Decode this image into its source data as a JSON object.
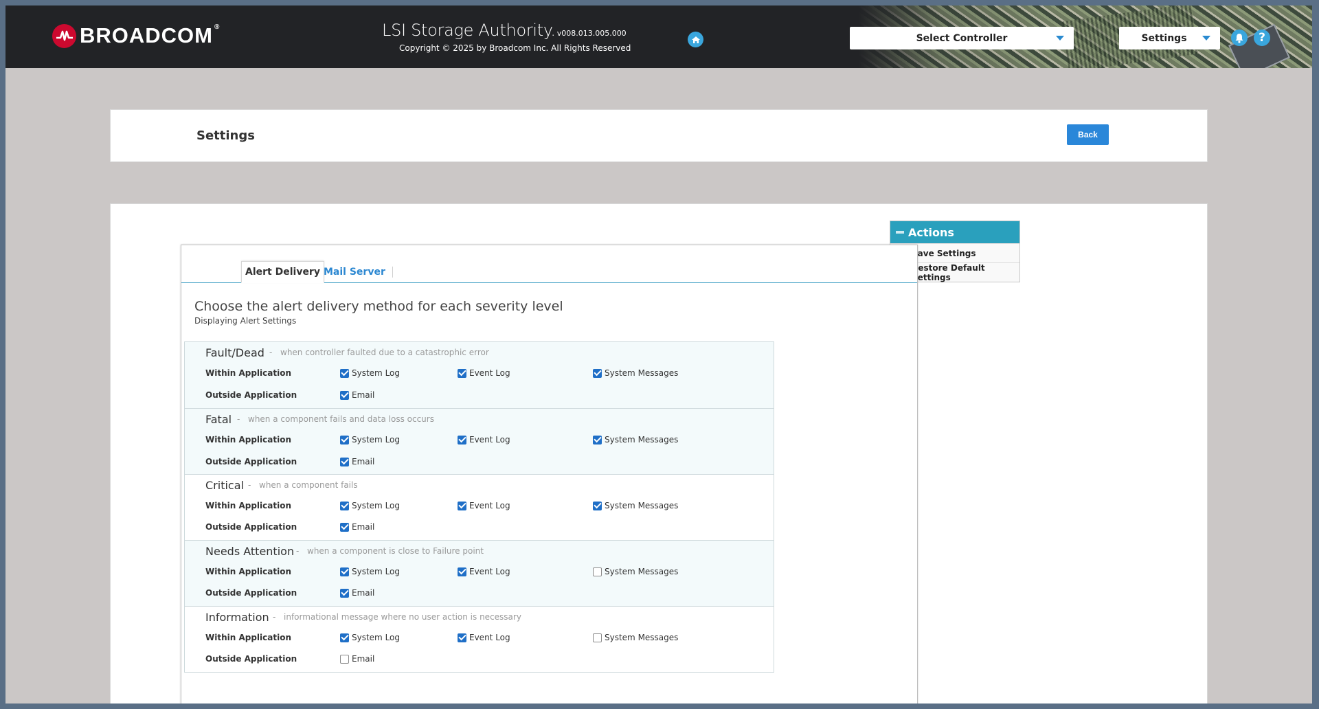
{
  "header": {
    "brand": "BROADCOM",
    "brand_mark": "®",
    "app_name": "LSI Storage Authority.",
    "version": "v008.013.005.000",
    "copyright": "Copyright © 2025 by Broadcom Inc. All Rights Reserved",
    "select_controller": "Select Controller",
    "settings_menu": "Settings",
    "help": "?"
  },
  "page": {
    "title": "Settings",
    "back": "Back"
  },
  "actions": {
    "title": "Actions",
    "save": "Save Settings",
    "restore": "Restore Default Settings"
  },
  "tabs": {
    "alert_delivery": "Alert Delivery",
    "mail_server": "Mail Server"
  },
  "main": {
    "heading": "Choose the alert delivery method for each severity level",
    "subheading": "Displaying Alert Settings"
  },
  "labels": {
    "within": "Within Application",
    "outside": "Outside Application",
    "system_log": "System Log",
    "event_log": "Event Log",
    "system_messages": "System Messages",
    "email": "Email",
    "dash": "-"
  },
  "severities": [
    {
      "name": "Fault/Dead",
      "desc": "when controller faulted due to a catastrophic error",
      "system_log": true,
      "event_log": true,
      "system_messages": true,
      "email": true
    },
    {
      "name": "Fatal",
      "desc": "when a component fails and data loss occurs",
      "system_log": true,
      "event_log": true,
      "system_messages": true,
      "email": true
    },
    {
      "name": "Critical",
      "desc": "when a component fails",
      "system_log": true,
      "event_log": true,
      "system_messages": true,
      "email": true
    },
    {
      "name": "Needs Attention",
      "desc": "when a component is close to Failure point",
      "system_log": true,
      "event_log": true,
      "system_messages": false,
      "email": true
    },
    {
      "name": "Information",
      "desc": "informational message where no user action is necessary",
      "system_log": true,
      "event_log": true,
      "system_messages": false,
      "email": false
    }
  ],
  "colors": {
    "accent": "#2a87d9",
    "actions_header": "#2aa0bd",
    "header_bg": "#222326",
    "checkbox_on": "#1f6fc7"
  }
}
